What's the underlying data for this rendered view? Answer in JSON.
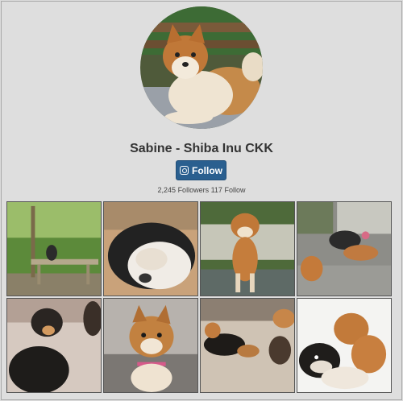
{
  "profile": {
    "name": "Sabine - Shiba Inu CKK",
    "follow_label": "Follow",
    "followers_count": "2,245",
    "followers_label": "Followers",
    "following_count": "117",
    "following_label": "Follow"
  },
  "photos": [
    {
      "name": "photo-dog-on-picnic-table"
    },
    {
      "name": "photo-sleeping-dog-closeup"
    },
    {
      "name": "photo-puppy-standing-on-deck"
    },
    {
      "name": "photo-puppies-on-deck"
    },
    {
      "name": "photo-black-tan-puppies"
    },
    {
      "name": "photo-puppy-with-pink-collar"
    },
    {
      "name": "photo-puppies-on-bed"
    },
    {
      "name": "photo-puppies-playing"
    }
  ]
}
